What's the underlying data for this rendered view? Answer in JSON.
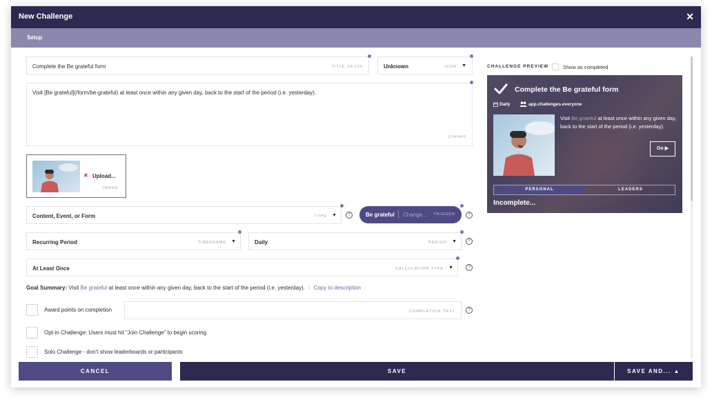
{
  "dialog": {
    "title": "New Challenge",
    "close_symbol": "✕",
    "section_tab": "Setup"
  },
  "form": {
    "title_field": {
      "value": "Complete the Be grateful form",
      "label": "TITLE 29/120"
    },
    "icon_field": {
      "value": "Unknown",
      "label": "ICON"
    },
    "description": {
      "value": "Visit [Be grateful](/form/be-grateful) at least once within any given day, back to the start of the period (i.e. yesterday).",
      "counter": "124/400"
    },
    "image": {
      "remove_symbol": "✖",
      "upload_label": "Upload...",
      "label": "IMAGE"
    },
    "type_field": {
      "value": "Content, Event, or Form",
      "label": "TYPE"
    },
    "trigger": {
      "value": "Be grateful",
      "change": "Change...",
      "label": "TRIGGER"
    },
    "timeframe_field": {
      "value": "Recurring Period",
      "label": "TIMEFRAME"
    },
    "period_field": {
      "value": "Daily",
      "label": "PERIOD"
    },
    "calculation_field": {
      "value": "At Least Once",
      "label": "CALCULATION TYPE"
    },
    "goal_summary": {
      "label": "Goal Summary:",
      "prefix": "Visit",
      "link": "Be grateful",
      "suffix": "at least once within any given day, back to the start of the period (i.e. yesterday).",
      "divider": "|",
      "copy_link": "Copy to description"
    },
    "award_points": {
      "label": "Award points on completion",
      "completion_text_label": "COMPLETION TEXT"
    },
    "opt_in": {
      "label": "Opt-in Challenge: Users must hit \"Join Challenge\" to begin scoring"
    },
    "solo": {
      "label": "Solo Challenge - don't show leaderboards or participants"
    },
    "help_symbol": "?",
    "caret_symbol": "▼"
  },
  "preview": {
    "label": "CHALLENGE PREVIEW",
    "show_completed_label": "Show as completed",
    "card": {
      "title": "Complete the Be grateful form",
      "period": "Daily",
      "audience": "app.challenges.everyone",
      "desc_prefix": "Visit",
      "desc_link": "Be grateful",
      "desc_suffix": "at least once within any given day, back to the start of the period (i.e. yesterday).",
      "go_label": "Go ▶",
      "tab_personal": "PERSONAL",
      "tab_leaders": "LEADERS",
      "status": "Incomplete..."
    }
  },
  "footer": {
    "cancel": "CANCEL",
    "save": "SAVE",
    "save_and": "SAVE AND... ▲"
  },
  "colors": {
    "titlebar": "#2c2a50",
    "subbar": "#8a88ad",
    "accent": "#7873b8",
    "trigger_pill": "#4e4b84",
    "cancel_button": "#4e4b84",
    "save_button": "#2c2a50"
  },
  "icons": {
    "close": "close-icon",
    "remove_image": "remove-icon",
    "caret": "chevron-down-icon",
    "help": "help-icon",
    "check": "checkmark-icon",
    "calendar": "calendar-icon",
    "users": "users-icon"
  }
}
